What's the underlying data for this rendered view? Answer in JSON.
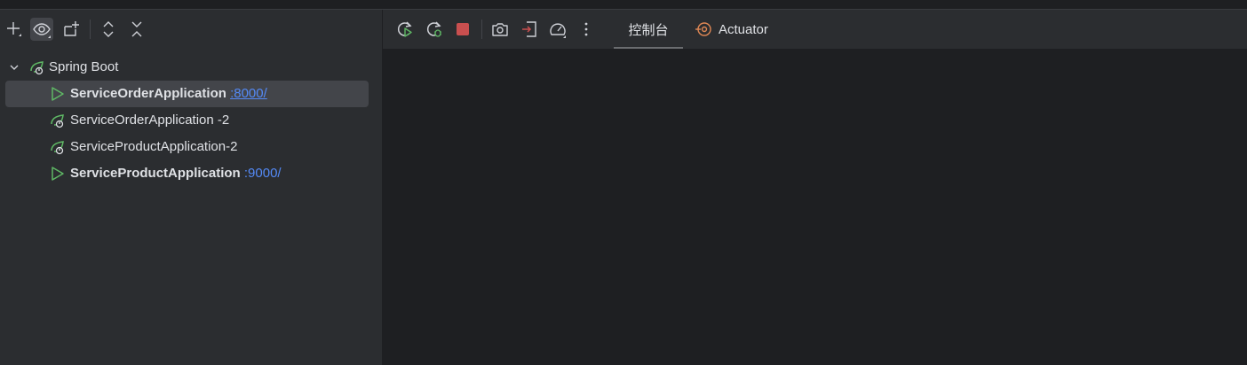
{
  "left_toolbar": {
    "buttons": [
      {
        "name": "add-icon"
      },
      {
        "name": "eye-icon"
      },
      {
        "name": "new-group-icon"
      },
      {
        "name": "expand-all-icon"
      },
      {
        "name": "collapse-all-icon"
      }
    ]
  },
  "tree": {
    "group": {
      "label": "Spring Boot"
    },
    "items": [
      {
        "label": "ServiceOrderApplication",
        "port": ":8000/",
        "status": "running"
      },
      {
        "label": "ServiceOrderApplication -2",
        "port": "",
        "status": "stopped"
      },
      {
        "label": "ServiceProductApplication-2",
        "port": "",
        "status": "stopped"
      },
      {
        "label": "ServiceProductApplication",
        "port": ":9000/",
        "status": "running"
      }
    ]
  },
  "right_toolbar": {
    "buttons": [
      {
        "name": "rerun-icon"
      },
      {
        "name": "rerun-debug-icon"
      },
      {
        "name": "stop-icon"
      },
      {
        "name": "camera-icon"
      },
      {
        "name": "exit-icon"
      },
      {
        "name": "gauge-icon"
      },
      {
        "name": "more-icon"
      }
    ],
    "tabs": [
      {
        "label": "控制台",
        "selected": true
      },
      {
        "label": "Actuator",
        "selected": false
      }
    ]
  },
  "colors": {
    "panel": "#2b2d30",
    "editor": "#1e1f22",
    "selection": "#43454a",
    "link": "#548af7",
    "green": "#5fb865",
    "stop_red": "#c94f4f",
    "actuator_orange": "#e08855"
  }
}
